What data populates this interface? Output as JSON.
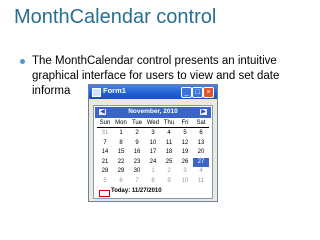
{
  "slide": {
    "title": "MonthCalendar control",
    "bullet": "The MonthCalendar control presents an intuitive graphical interface for users to view and set date informa"
  },
  "window": {
    "title": "Form1",
    "minimize_glyph": "_",
    "maximize_glyph": "□",
    "close_glyph": "×"
  },
  "calendar": {
    "month_label": "November, 2010",
    "prev_glyph": "◀",
    "next_glyph": "▶",
    "days_of_week": [
      "Sun",
      "Mon",
      "Tue",
      "Wed",
      "Thu",
      "Fri",
      "Sat"
    ],
    "weeks": [
      [
        "31",
        "1",
        "2",
        "3",
        "4",
        "5",
        "6"
      ],
      [
        "7",
        "8",
        "9",
        "10",
        "11",
        "12",
        "13"
      ],
      [
        "14",
        "15",
        "16",
        "17",
        "18",
        "19",
        "20"
      ],
      [
        "21",
        "22",
        "23",
        "24",
        "25",
        "26",
        "27"
      ],
      [
        "28",
        "29",
        "30",
        "1",
        "2",
        "3",
        "4"
      ],
      [
        "5",
        "6",
        "7",
        "8",
        "9",
        "10",
        "11"
      ]
    ],
    "selected_day": "27",
    "today_label": "Today: 11/27/2010",
    "colors": {
      "header": "#3a64c6",
      "selected": "#3a64c6",
      "today_marker": "#c00000"
    }
  }
}
